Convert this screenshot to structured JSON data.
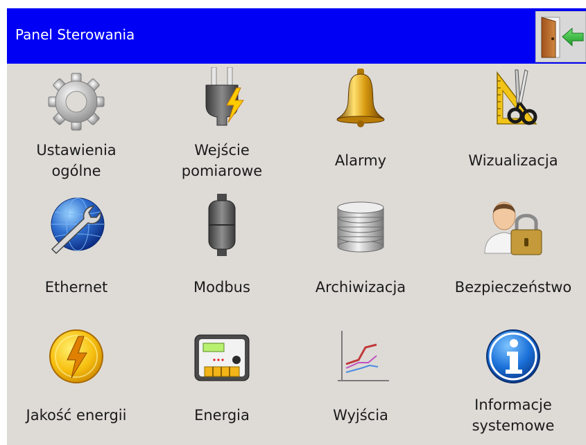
{
  "header": {
    "title": "Panel Sterowania",
    "background": "#0000f4",
    "exit_icon": "exit-door-icon"
  },
  "main": {
    "background": "#dedbd7"
  },
  "tiles": [
    {
      "label_line1": "Ustawienia",
      "label_line2": "ogólne",
      "icon": "gear-icon"
    },
    {
      "label_line1": "Wejście",
      "label_line2": "pomiarowe",
      "icon": "plug-lightning-icon"
    },
    {
      "label_line1": "Alarmy",
      "label_line2": "",
      "icon": "bell-icon"
    },
    {
      "label_line1": "Wizualizacja",
      "label_line2": "",
      "icon": "ruler-scissors-icon"
    },
    {
      "label_line1": "Ethernet",
      "label_line2": "",
      "icon": "globe-wrench-icon"
    },
    {
      "label_line1": "Modbus",
      "label_line2": "",
      "icon": "modbus-device-icon"
    },
    {
      "label_line1": "Archiwizacja",
      "label_line2": "",
      "icon": "database-stack-icon"
    },
    {
      "label_line1": "Bezpieczeństwo",
      "label_line2": "",
      "icon": "user-lock-icon"
    },
    {
      "label_line1": "Jakość energii",
      "label_line2": "",
      "icon": "lightning-circle-icon"
    },
    {
      "label_line1": "Energia",
      "label_line2": "",
      "icon": "energy-meter-icon"
    },
    {
      "label_line1": "Wyjścia",
      "label_line2": "",
      "icon": "line-chart-icon"
    },
    {
      "label_line1": "Informacje",
      "label_line2": "systemowe",
      "icon": "info-icon"
    }
  ]
}
